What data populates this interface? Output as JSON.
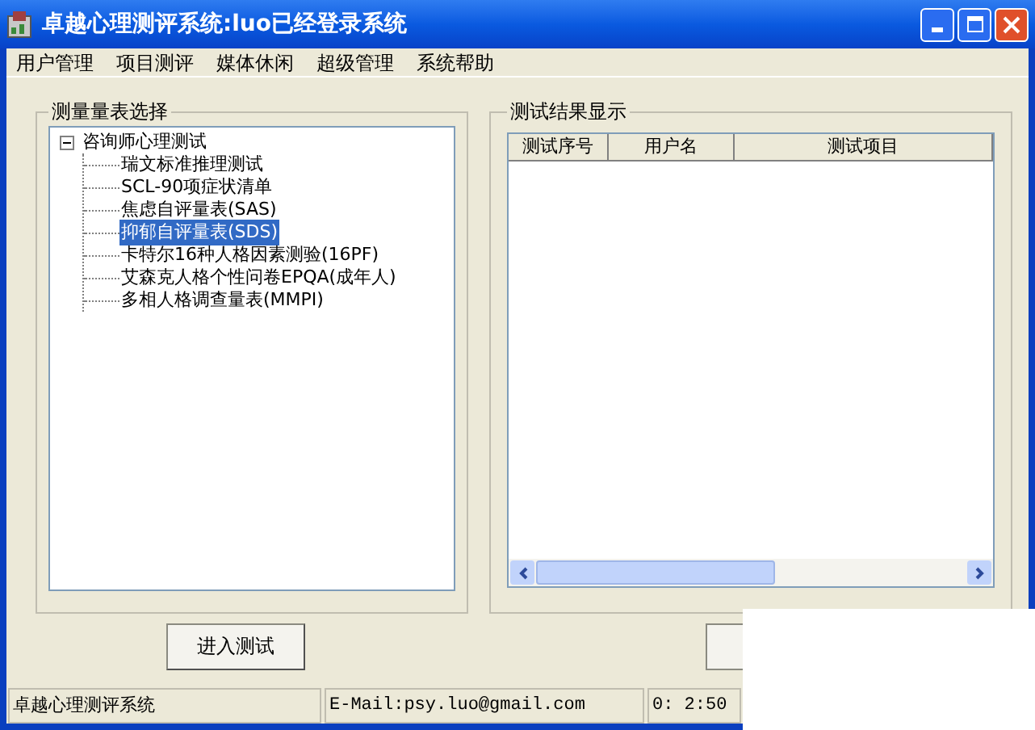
{
  "window": {
    "title": "卓越心理测评系统:luo已经登录系统"
  },
  "menu": [
    "用户管理",
    "项目测评",
    "媒体休闲",
    "超级管理",
    "系统帮助"
  ],
  "left_group": {
    "title": "测量量表选择",
    "tree": [
      {
        "label": "咨询师心理测试",
        "expanded": true,
        "children": [
          {
            "label": "瑞文标准推理测试",
            "selected": false
          },
          {
            "label": "SCL-90项症状清单",
            "selected": false
          },
          {
            "label": "焦虑自评量表(SAS)",
            "selected": false
          },
          {
            "label": "抑郁自评量表(SDS)",
            "selected": true
          },
          {
            "label": "卡特尔16种人格因素测验(16PF)",
            "selected": false
          },
          {
            "label": "艾森克人格个性问卷EPQA(成年人)",
            "selected": false
          },
          {
            "label": "多相人格调查量表(MMPI)",
            "selected": false
          }
        ]
      }
    ]
  },
  "right_group": {
    "title": "测试结果显示",
    "columns": [
      "测试序号",
      "用户名",
      "测试项目"
    ]
  },
  "buttons": [
    "进入测试"
  ],
  "status_bar": [
    "卓越心理测评系统",
    "E-Mail:psy.luo@gmail.com",
    "0: 2:50"
  ]
}
